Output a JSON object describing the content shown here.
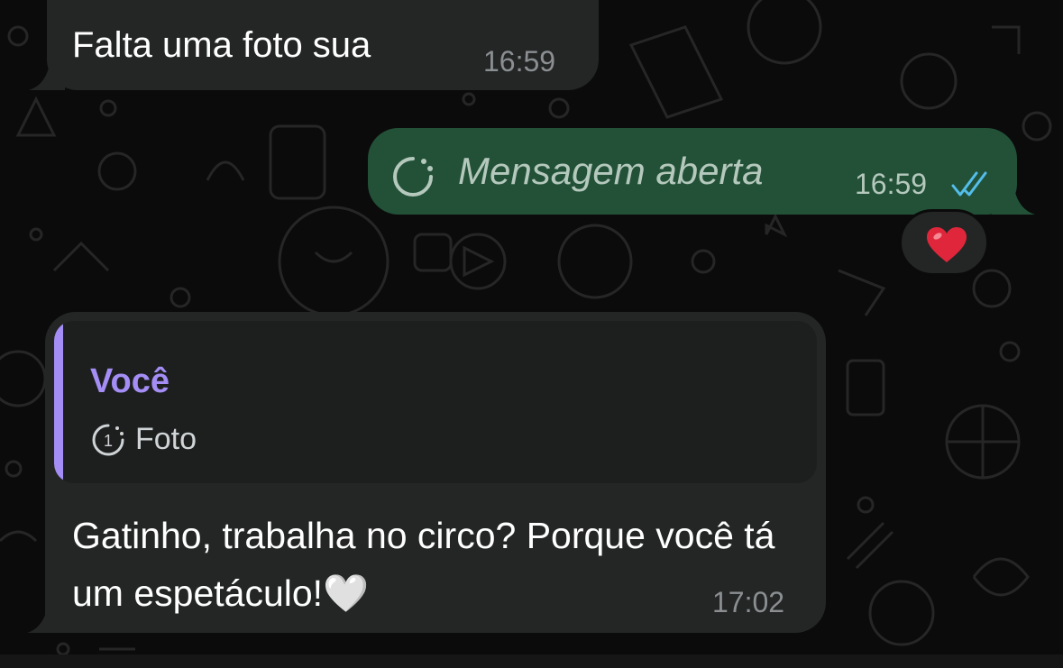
{
  "messages": [
    {
      "direction": "incoming",
      "text": "Falta uma foto sua",
      "time": "16:59"
    },
    {
      "direction": "outgoing",
      "text": "Mensagem aberta",
      "time": "16:59",
      "view_once_icon": "view-once-icon",
      "status_icon": "double-check-read-icon",
      "reaction": "❤️"
    },
    {
      "direction": "incoming",
      "quote": {
        "author": "Você",
        "icon": "view-once-photo-icon",
        "label": "Foto"
      },
      "text": "Gatinho,  trabalha no circo? Porque você tá um espetáculo!🤍",
      "time": "17:02"
    }
  ],
  "colors": {
    "background": "#0b0b0b",
    "incoming_bubble": "#242626",
    "outgoing_bubble": "#225138",
    "quote_accent": "#a48ef5",
    "read_ticks": "#53bdeb"
  }
}
